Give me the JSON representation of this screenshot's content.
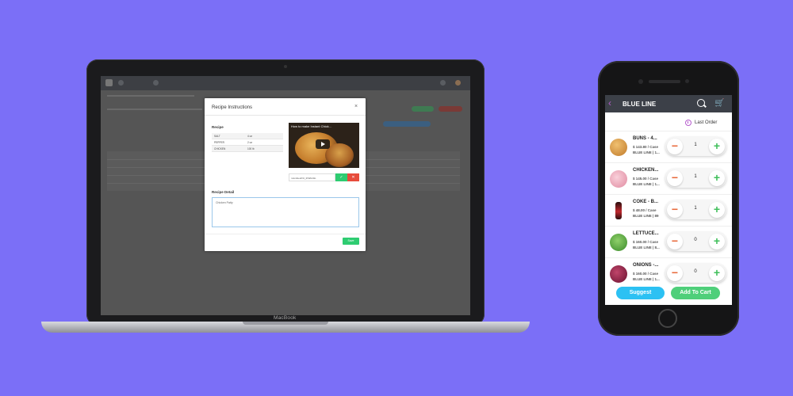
{
  "laptop": {
    "brand": "MacBook",
    "modal": {
      "title": "Recipe Instructions",
      "close": "×",
      "recipe_label": "Recipe",
      "ingredients": [
        {
          "name": "SALT",
          "qty": "4 oz"
        },
        {
          "name": "PEPPER",
          "qty": "2 oz"
        },
        {
          "name": "CHICKEN",
          "qty": "100 lb"
        }
      ],
      "video_title": "How to make Instant Chick…",
      "video_url": "m/embed/zU_tKWkz4lo",
      "detail_label": "Recipe Detail",
      "detail_text": "Chicken Patty",
      "save_label": "Save"
    }
  },
  "phone": {
    "title": "BLUE LINE",
    "last_order_label": "Last Order",
    "items": [
      {
        "name": "BUNS - 4...",
        "price": "$ 143.80 / Case",
        "vendor": "BLUE LINE | 1...",
        "qty": "1",
        "color": "#d99a3a"
      },
      {
        "name": "CHICKEN...",
        "price": "$ 145.00 / Case",
        "vendor": "BLUE LINE | 1...",
        "qty": "1",
        "color": "#f3a6b6"
      },
      {
        "name": "COKE - B...",
        "price": "$ 48.00 / Case",
        "vendor": "BLUE LINE | 89",
        "qty": "1",
        "color": "#c0282e"
      },
      {
        "name": "LETTUCE...",
        "price": "$ 160.00 / Case",
        "vendor": "BLUE LINE | 8...",
        "qty": "0",
        "color": "#4fa83a"
      },
      {
        "name": "ONIONS -...",
        "price": "$ 160.00 / Case",
        "vendor": "BLUE LINE | 1...",
        "qty": "0",
        "color": "#8a1d3a"
      }
    ],
    "suggest_label": "Suggest",
    "add_to_cart_label": "Add To Cart"
  },
  "colors": {
    "background": "#7b6ff7",
    "accent_purple": "#b55ccd",
    "minus": "#e8693a",
    "plus": "#3fbf5a",
    "suggest": "#2cc1f3",
    "add_to_cart": "#4fcf7a"
  }
}
